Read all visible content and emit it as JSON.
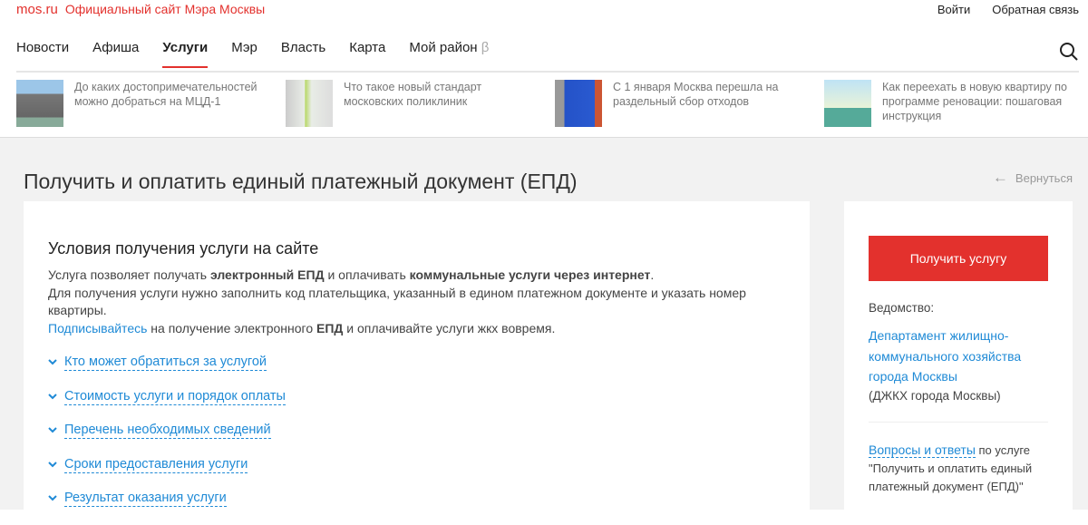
{
  "header": {
    "logo": "mos.ru",
    "tagline": "Официальный сайт Мэра Москвы",
    "login": "Войти",
    "feedback": "Обратная связь"
  },
  "nav": {
    "items": [
      "Новости",
      "Афиша",
      "Услуги",
      "Мэр",
      "Власть",
      "Карта",
      "Мой район"
    ],
    "beta": "β",
    "active": "Услуги"
  },
  "news": [
    "До каких достопримечательностей можно добраться на МЦД-1",
    "Что такое новый стандарт московских поликлиник",
    "С 1 января Москва перешла на раздельный сбор отходов",
    "Как переехать в новую квартиру по программе реновации: пошаговая инструкция"
  ],
  "page": {
    "title": "Получить и оплатить единый платежный документ (ЕПД)",
    "back": "Вернуться"
  },
  "main": {
    "heading": "Условия получения услуги на сайте",
    "p1a": "Услуга позволяет получать ",
    "p1b": "электронный ЕПД",
    "p1c": " и оплачивать ",
    "p1d": "коммунальные услуги через интернет",
    "p1e": ".",
    "p2": "Для получения услуги нужно заполнить код плательщика, указанный в едином платежном документе и указать номер квартиры.",
    "p3a": "Подписывайтесь",
    "p3b": " на получение электронного ",
    "p3c": "ЕПД",
    "p3d": " и оплачивайте услуги жкх вовремя.",
    "accordion": [
      "Кто может обратиться за услугой",
      "Стоимость услуги и порядок оплаты",
      "Перечень необходимых сведений",
      "Сроки предоставления услуги",
      "Результат оказания услуги"
    ]
  },
  "side": {
    "button": "Получить услугу",
    "agency_label": "Ведомство:",
    "agency": "Департамент жилищно-коммунального хозяйства города Москвы",
    "agency_short": "(ДЖКХ города Москвы)",
    "faq_link": "Вопросы и ответы",
    "faq_text": " по услуге",
    "faq_service": "\"Получить и оплатить единый платежный документ (ЕПД)\""
  },
  "colors": {
    "accent": "#e3312d",
    "link": "#1f8ad6"
  }
}
